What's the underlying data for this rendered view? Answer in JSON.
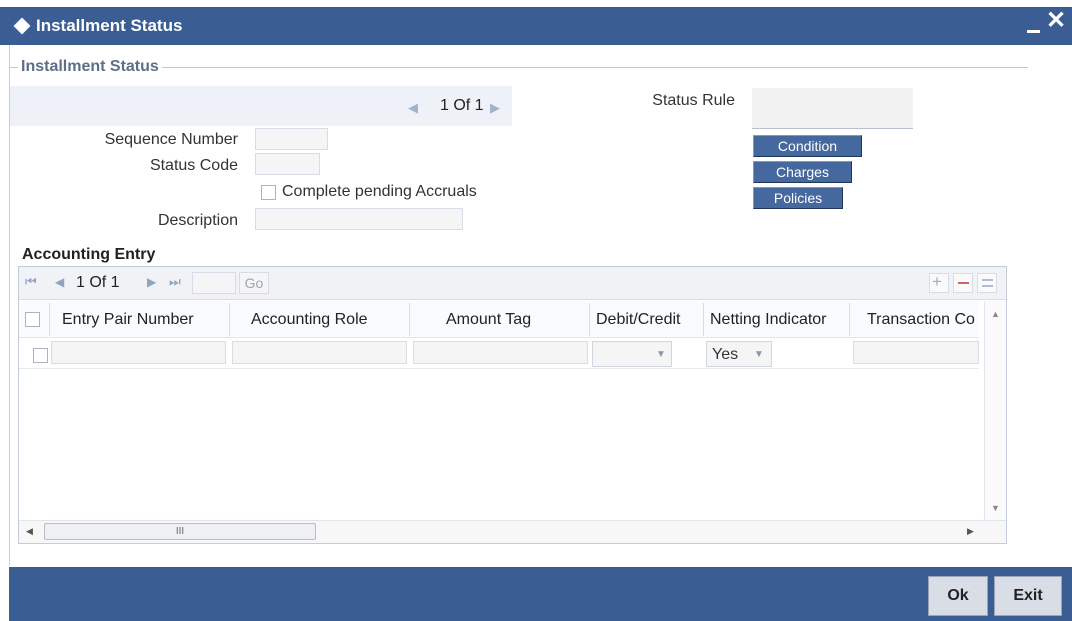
{
  "window": {
    "title": "Installment Status",
    "minimize": "_",
    "close": "✕"
  },
  "group": {
    "title": "Installment Status"
  },
  "navigator": {
    "prev": "◀",
    "page_text": "1 Of 1",
    "next": "▶"
  },
  "fields": {
    "sequence_number_label": "Sequence Number",
    "sequence_number_value": "",
    "status_code_label": "Status Code",
    "status_code_value": "",
    "complete_pending_accruals_label": "Complete pending Accruals",
    "complete_pending_accruals_checked": false,
    "description_label": "Description",
    "description_value": "",
    "status_rule_label": "Status Rule",
    "status_rule_value": ""
  },
  "side_buttons": {
    "condition": "Condition",
    "charges": "Charges",
    "policies": "Policies"
  },
  "accounting_entry": {
    "title": "Accounting Entry",
    "pager": {
      "first": "⏮",
      "prev": "◀",
      "page_text": "1 Of 1",
      "next": "▶",
      "last": "⏭",
      "goto_value": "",
      "go": "Go"
    },
    "toolbar_icons": [
      "add-row-icon",
      "delete-row-icon",
      "view-rows-icon"
    ],
    "columns": [
      "Entry Pair Number",
      "Accounting Role",
      "Amount Tag",
      "Debit/Credit",
      "Netting Indicator",
      "Transaction Co"
    ],
    "rows": [
      {
        "entry_pair_number": "",
        "accounting_role": "",
        "amount_tag": "",
        "debit_credit": "",
        "netting_indicator": "Yes",
        "transaction_code": ""
      }
    ],
    "hscroll_grip": "III"
  },
  "footer": {
    "ok": "Ok",
    "exit": "Exit"
  }
}
